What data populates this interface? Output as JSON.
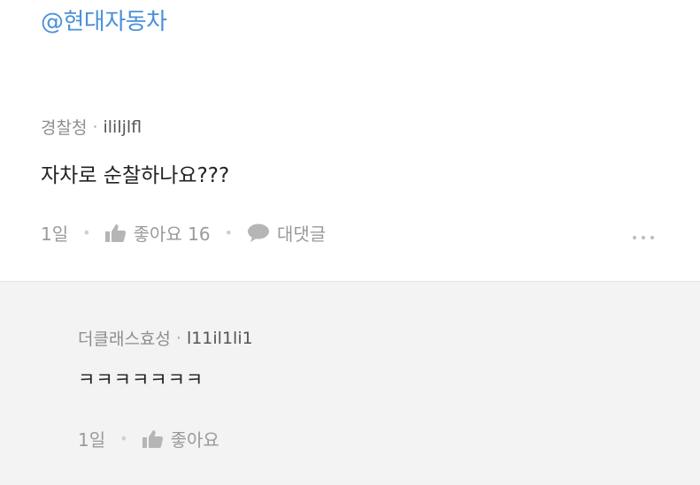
{
  "mention": "@현대자동차",
  "comment": {
    "author": "경찰청",
    "separator": "·",
    "handle": "ililjlfl",
    "text": "자차로 순찰하나요???",
    "time": "1일",
    "like_label": "좋아요 16",
    "reply_label": "대댓글",
    "more_icon": "more-dots-icon"
  },
  "reply": {
    "author": "더클래스효성",
    "separator": "·",
    "handle": "l11il1li1",
    "text": "ㅋㅋㅋㅋㅋㅋㅋ",
    "time": "1일",
    "like_label": "좋아요"
  },
  "colors": {
    "mention": "#4a90d9",
    "muted": "#9a9a9a",
    "reply_bg": "#f3f3f3"
  },
  "icons": [
    "thumbs-up-icon",
    "speech-bubble-icon",
    "more-dots-icon"
  ]
}
